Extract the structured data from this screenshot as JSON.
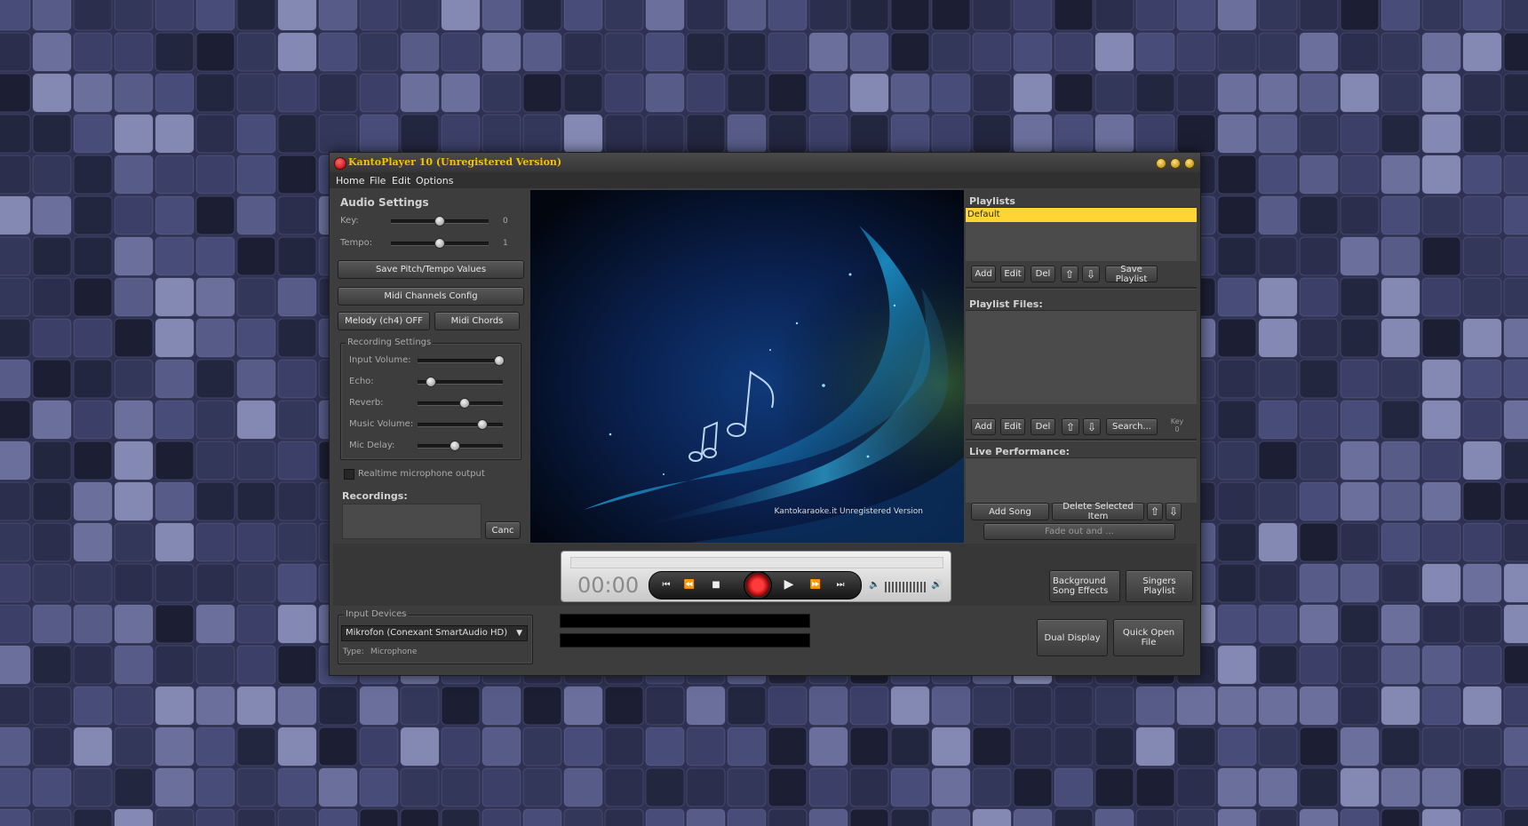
{
  "window": {
    "title": "KantoPlayer 10 (Unregistered Version)"
  },
  "menu": [
    "Home",
    "File",
    "Edit",
    "Options"
  ],
  "audio_settings": {
    "title": "Audio Settings",
    "key_label": "Key:",
    "key_value": "0",
    "tempo_label": "Tempo:",
    "tempo_value": "1",
    "save_button": "Save Pitch/Tempo Values",
    "midi_channels_button": "Midi Channels Config",
    "melody_button": "Melody (ch4) OFF",
    "midi_chords_button": "Midi Chords"
  },
  "recording_settings": {
    "title": "Recording Settings",
    "sliders": [
      {
        "label": "Input Volume:",
        "level": 1.0
      },
      {
        "label": "Echo:",
        "level": 0.1
      },
      {
        "label": "Reverb:",
        "level": 0.55
      },
      {
        "label": "Music Volume:",
        "level": 0.78
      },
      {
        "label": "Mic Delay:",
        "level": 0.42
      }
    ],
    "realtime_label": "Realtime microphone output",
    "realtime_checked": false
  },
  "recordings": {
    "title": "Recordings:",
    "cancel_button": "Canc"
  },
  "video": {
    "watermark": "Kantokaraoke.it Unregistered Version"
  },
  "playlists": {
    "title": "Playlists",
    "items": [
      "Default"
    ],
    "add": "Add",
    "edit": "Edit",
    "del": "Del",
    "save": "Save Playlist"
  },
  "playlist_files": {
    "title": "Playlist Files:",
    "add": "Add",
    "edit": "Edit",
    "del": "Del",
    "search": "Search...",
    "key_label": "Key",
    "key_value": "0"
  },
  "live_performance": {
    "title": "Live Performance:",
    "add_song": "Add Song",
    "delete_selected": "Delete Selected Item",
    "fade_out": "Fade out and ..."
  },
  "transport": {
    "time": "00:00",
    "progress": 0
  },
  "side_buttons": {
    "background_effects": "Background Song Effects",
    "singers_playlist": "Singers Playlist",
    "dual_display": "Dual Display",
    "quick_open": "Quick Open File"
  },
  "input_devices": {
    "title": "Input Devices",
    "selected": "Mikrofon (Conexant SmartAudio HD)",
    "type_label": "Type:",
    "type_value": "Microphone"
  },
  "colors": {
    "title_text": "#f2c400",
    "selection": "#ffd433",
    "record": "#e00000",
    "background": "#2e3152"
  }
}
